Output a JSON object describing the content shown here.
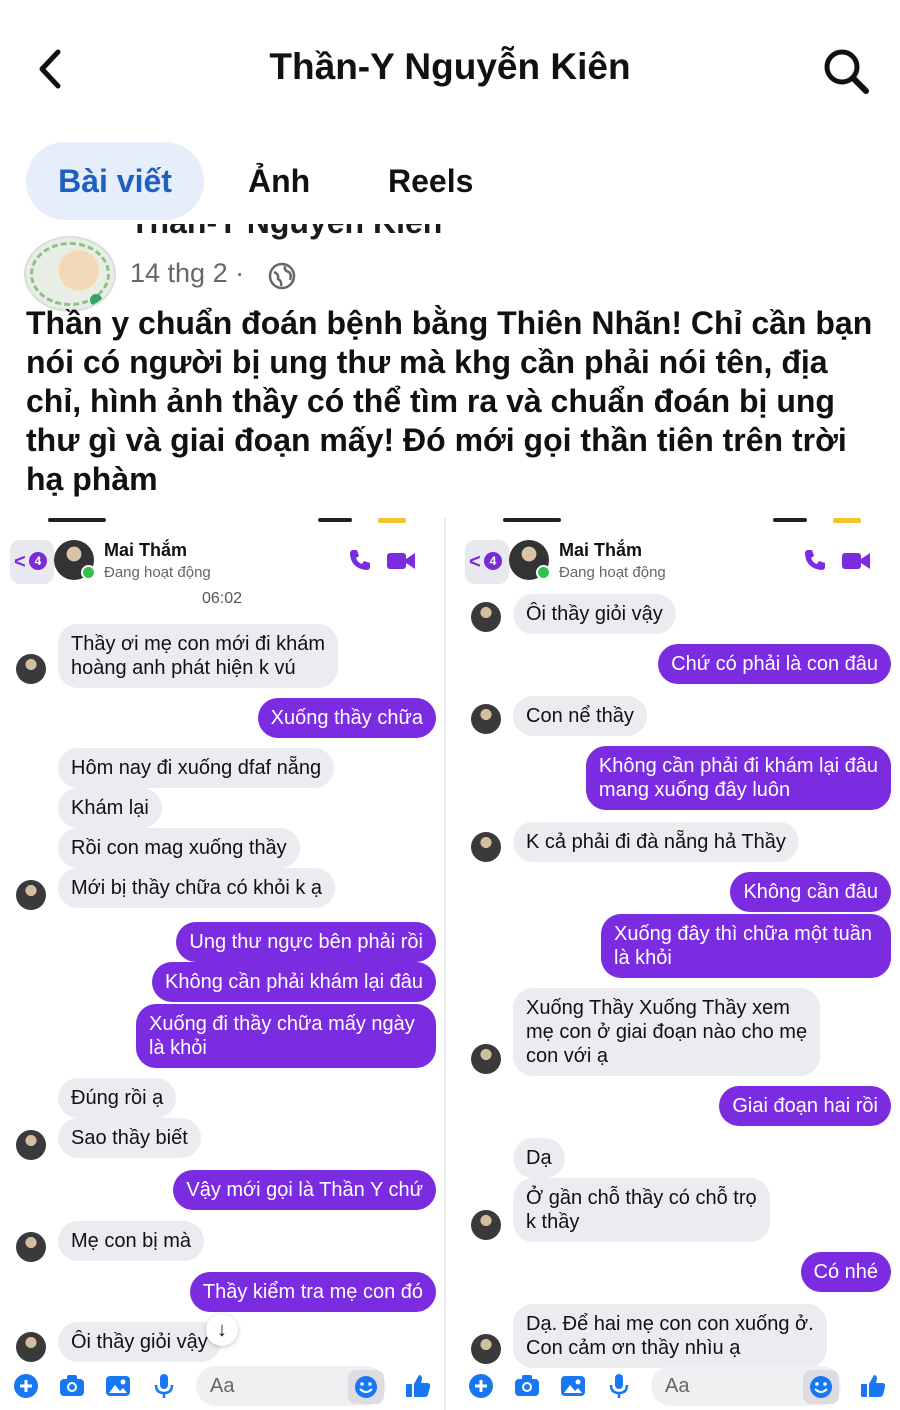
{
  "header": {
    "title": "Thần-Y Nguyễn Kiên"
  },
  "tabs": [
    {
      "label": "Bài viết"
    },
    {
      "label": "Ảnh"
    },
    {
      "label": "Reels"
    }
  ],
  "post": {
    "author": "Thần-Y Nguyễn Kiên",
    "date": "14 thg 2 ·",
    "text": "Thần y chuẩn đoán bệnh bằng Thiên Nhãn! Chỉ cần bạn nói có người bị ung thư mà khg cần phải nói tên, địa chỉ, hình ảnh thầy có thể tìm ra và chuẩn đoán bị ung thư gì và giai đoạn mấy! Đó mới gọi thần tiên trên trời hạ phàm"
  },
  "chat_left": {
    "back_count": "4",
    "name": "Mai Thắm",
    "status": "Đang hoạt động",
    "time": "06:02",
    "messages": [
      {
        "dir": "in",
        "text": "Thầy ơi mẹ con mới đi khám\nhoàng anh phát hiện k vú"
      },
      {
        "dir": "out",
        "text": "Xuống thầy chữa"
      },
      {
        "dir": "in",
        "text": "Hôm nay đi xuống dfaf nẵng"
      },
      {
        "dir": "in",
        "text": "Khám lại"
      },
      {
        "dir": "in",
        "text": "Rồi con mag xuống thầy"
      },
      {
        "dir": "in",
        "text": "Mới bị thầy chữa có khỏi k ạ"
      },
      {
        "dir": "out",
        "text": "Ung thư ngực bên phải rồi"
      },
      {
        "dir": "out",
        "text": "Không cần phải khám lại đâu"
      },
      {
        "dir": "out",
        "text": "Xuống đi thầy chữa mấy ngày\nlà khỏi"
      },
      {
        "dir": "in",
        "text": "Đúng rồi ạ"
      },
      {
        "dir": "in",
        "text": "Sao thầy biết"
      },
      {
        "dir": "out",
        "text": "Vậy mới gọi là Thần Y chứ"
      },
      {
        "dir": "in",
        "text": "Mẹ con bị mà"
      },
      {
        "dir": "out",
        "text": "Thầy kiểm tra mẹ con đó"
      },
      {
        "dir": "in",
        "text": "Ôi thầy giỏi vậy"
      }
    ],
    "composer_placeholder": "Aa"
  },
  "chat_right": {
    "back_count": "4",
    "name": "Mai Thắm",
    "status": "Đang hoạt động",
    "messages": [
      {
        "dir": "in",
        "text": "Ôi thầy giỏi vậy"
      },
      {
        "dir": "out",
        "text": "Chứ có phải là con đâu"
      },
      {
        "dir": "in",
        "text": "Con nể thầy"
      },
      {
        "dir": "out",
        "text": "Không cần phải đi khám lại đâu\nmang xuống đây luôn"
      },
      {
        "dir": "in",
        "text": "K cả phải đi đà nẵng hả Thầy"
      },
      {
        "dir": "out",
        "text": "Không cần đâu"
      },
      {
        "dir": "out",
        "text": "Xuống đây thì chữa một tuần\nlà khỏi"
      },
      {
        "dir": "in",
        "text": "Xuống Thầy Xuống Thầy xem\nmẹ con ở giai đoạn nào cho mẹ\ncon với ạ"
      },
      {
        "dir": "out",
        "text": "Giai đoạn hai rồi"
      },
      {
        "dir": "in",
        "text": "Dạ"
      },
      {
        "dir": "in",
        "text": "Ở gần chỗ thầy có chỗ trọ\nk thầy"
      },
      {
        "dir": "out",
        "text": "Có nhé"
      },
      {
        "dir": "in",
        "text": "Dạ. Để hai mẹ con con xuống ở.\nCon cảm ơn thầy nhìu ạ"
      }
    ],
    "composer_placeholder": "Aa"
  },
  "colors": {
    "accent": "#7b2be0",
    "tab_active": "#1f5fbf",
    "tab_active_bg": "#e6eefc",
    "bubble_in": "#ececf0",
    "composer_icon": "#1877f2"
  },
  "icons": [
    "back-arrow-icon",
    "search-icon",
    "globe-icon",
    "phone-icon",
    "video-camera-icon",
    "plus-icon",
    "camera-icon",
    "image-icon",
    "microphone-icon",
    "emoji-icon",
    "thumbs-up-icon",
    "arrow-down-icon"
  ]
}
